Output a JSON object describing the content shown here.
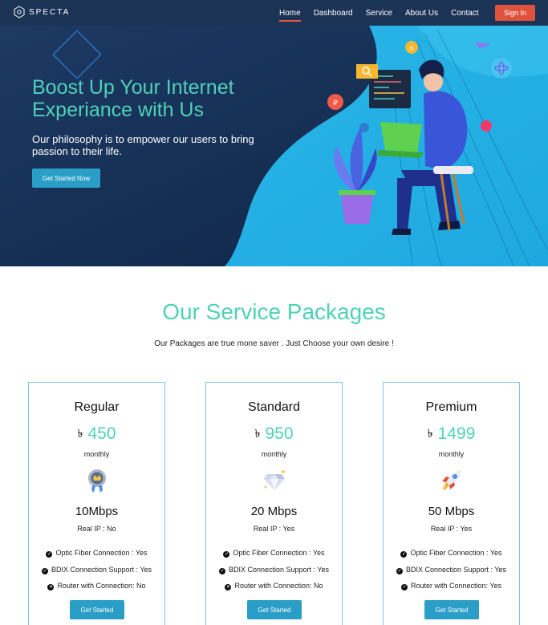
{
  "nav": {
    "logo_text": "SPECTA",
    "links": [
      "Home",
      "Dashboard",
      "Service",
      "About Us",
      "Contact"
    ],
    "signin_label": "Sign In"
  },
  "hero": {
    "title": "Boost Up Your Internet Experiance with Us",
    "subtitle": "Our philosophy is to empower our users to bring passion to their life.",
    "cta_label": "Get Started Now"
  },
  "section": {
    "title": "Our Service Packages",
    "subtitle": "Our Packages are true mone saver . Just Choose your own desire !"
  },
  "packages": [
    {
      "name": "Regular",
      "currency": "৳",
      "price": "450",
      "period": "monthly",
      "icon": "medal-icon",
      "speed": "10Mbps",
      "real_ip": "Real IP : No",
      "features": [
        {
          "text": "Optic Fiber Connection : Yes",
          "status": "yes"
        },
        {
          "text": "BDIX Connection Support : Yes",
          "status": "yes"
        },
        {
          "text": "Router with Connection: No",
          "status": "no"
        }
      ],
      "button": "Get Started"
    },
    {
      "name": "Standard",
      "currency": "৳",
      "price": "950",
      "period": "monthly",
      "icon": "diamond-icon",
      "speed": "20 Mbps",
      "real_ip": "Real IP : Yes",
      "features": [
        {
          "text": "Optic Fiber Connection : Yes",
          "status": "yes"
        },
        {
          "text": "BDIX Connection Support : Yes",
          "status": "yes"
        },
        {
          "text": "Router with Connection: No",
          "status": "no"
        }
      ],
      "button": "Get Started"
    },
    {
      "name": "Premium",
      "currency": "৳",
      "price": "1499",
      "period": "monthly",
      "icon": "rocket-icon",
      "speed": "50 Mbps",
      "real_ip": "Real IP : Yes",
      "features": [
        {
          "text": "Optic Fiber Connection : Yes",
          "status": "yes"
        },
        {
          "text": "BDIX Connection Support : Yes",
          "status": "yes"
        },
        {
          "text": "Router with Connection: Yes",
          "status": "yes"
        }
      ],
      "button": "Get Started"
    }
  ],
  "colors": {
    "nav_bg": "#1b3355",
    "accent_teal": "#4fd1b8",
    "button_blue": "#2b9ec7",
    "signin_red": "#e1523c",
    "card_border": "#7ec7e6"
  }
}
